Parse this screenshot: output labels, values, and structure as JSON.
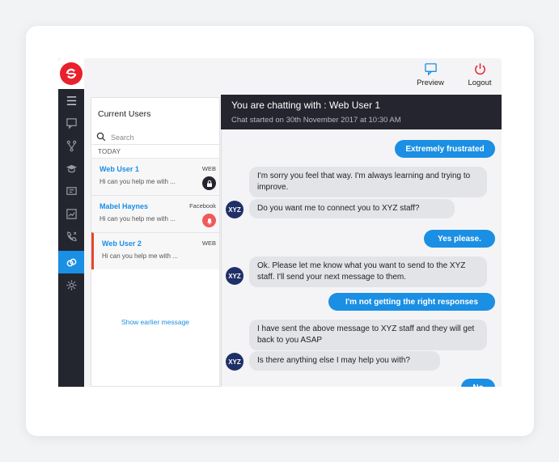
{
  "topbar": {
    "preview_label": "Preview",
    "logout_label": "Logout"
  },
  "users_panel": {
    "title": "Current Users",
    "search_placeholder": "Search",
    "section_label": "TODAY",
    "users": [
      {
        "name": "Web User 1",
        "preview": "Hi can you help me with ...",
        "source": "WEB",
        "badge_icon": "lock-icon"
      },
      {
        "name": "Mabel Haynes",
        "preview": "Hi can you help me with ...",
        "source": "Facebook",
        "badge_icon": "bell-icon"
      },
      {
        "name": "Web User 2",
        "preview": "Hi can you help me with ...",
        "source": "WEB"
      }
    ],
    "show_earlier": "Show earlier message"
  },
  "chat": {
    "title": "You are chatting with : Web User 1",
    "subtitle": "Chat started on 30th November 2017 at 10:30 AM",
    "avatar_text": "XYZ",
    "messages": [
      {
        "from": "user",
        "text": "Extremely frustrated"
      },
      {
        "from": "bot",
        "text": "I'm sorry you feel that way. I'm always learning and trying to improve."
      },
      {
        "from": "bot",
        "text": "Do you want me to connect you to XYZ staff?"
      },
      {
        "from": "user",
        "text": "Yes please."
      },
      {
        "from": "bot",
        "text": "Ok. Please let me know what you want to send to the XYZ staff. I'll send your next message to them."
      },
      {
        "from": "user",
        "text": "I'm not getting the right responses"
      },
      {
        "from": "bot",
        "text": "I have sent the above message to XYZ staff and they will get back to you ASAP"
      },
      {
        "from": "bot",
        "text": "Is there anything else I may help you with?"
      },
      {
        "from": "user",
        "text": "No"
      }
    ]
  },
  "colors": {
    "accent": "#1a8fe3",
    "sidebar": "#23252f",
    "brand_red": "#e8212d",
    "avatar": "#1f2f67"
  },
  "rail_icons": [
    "menu-icon",
    "chat-icon",
    "flow-icon",
    "graduation-cap-icon",
    "monitor-icon",
    "chart-icon",
    "phone-icon",
    "link-icon",
    "gear-icon"
  ]
}
